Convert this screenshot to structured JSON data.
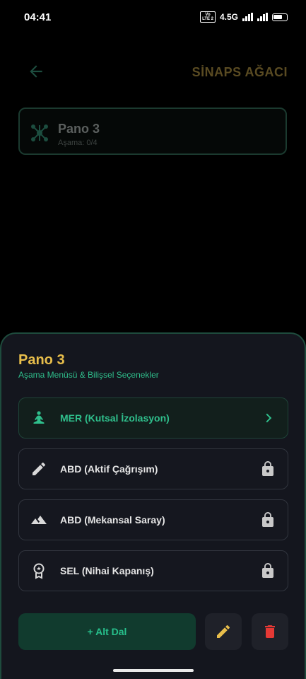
{
  "status_bar": {
    "time": "04:41",
    "volte_top": "Vo",
    "volte_bottom": "LTE 2",
    "network": "4.5G"
  },
  "header": {
    "title": "SİNAPS AĞACI"
  },
  "node": {
    "name": "Pano 3",
    "stage": "Aşama: 0/4"
  },
  "sheet": {
    "title": "Pano 3",
    "subtitle": "Aşama Menüsü & Bilişsel Seçenekler",
    "options": [
      {
        "label": "MER (Kutsal İzolasyon)",
        "icon": "meditation-icon",
        "trailing": "chevron-right-icon",
        "active": true
      },
      {
        "label": "ABD (Aktif Çağrışım)",
        "icon": "pencil-icon",
        "trailing": "lock-icon",
        "active": false
      },
      {
        "label": "ABD (Mekansal Saray)",
        "icon": "mountain-icon",
        "trailing": "lock-icon",
        "active": false
      },
      {
        "label": "SEL (Nihai Kapanış)",
        "icon": "award-icon",
        "trailing": "lock-icon",
        "active": false
      }
    ],
    "add_label": "+ Alt Dal"
  },
  "colors": {
    "accent_green": "#2fbf8c",
    "accent_gold": "#e8be4b",
    "delete_red": "#e53935"
  }
}
